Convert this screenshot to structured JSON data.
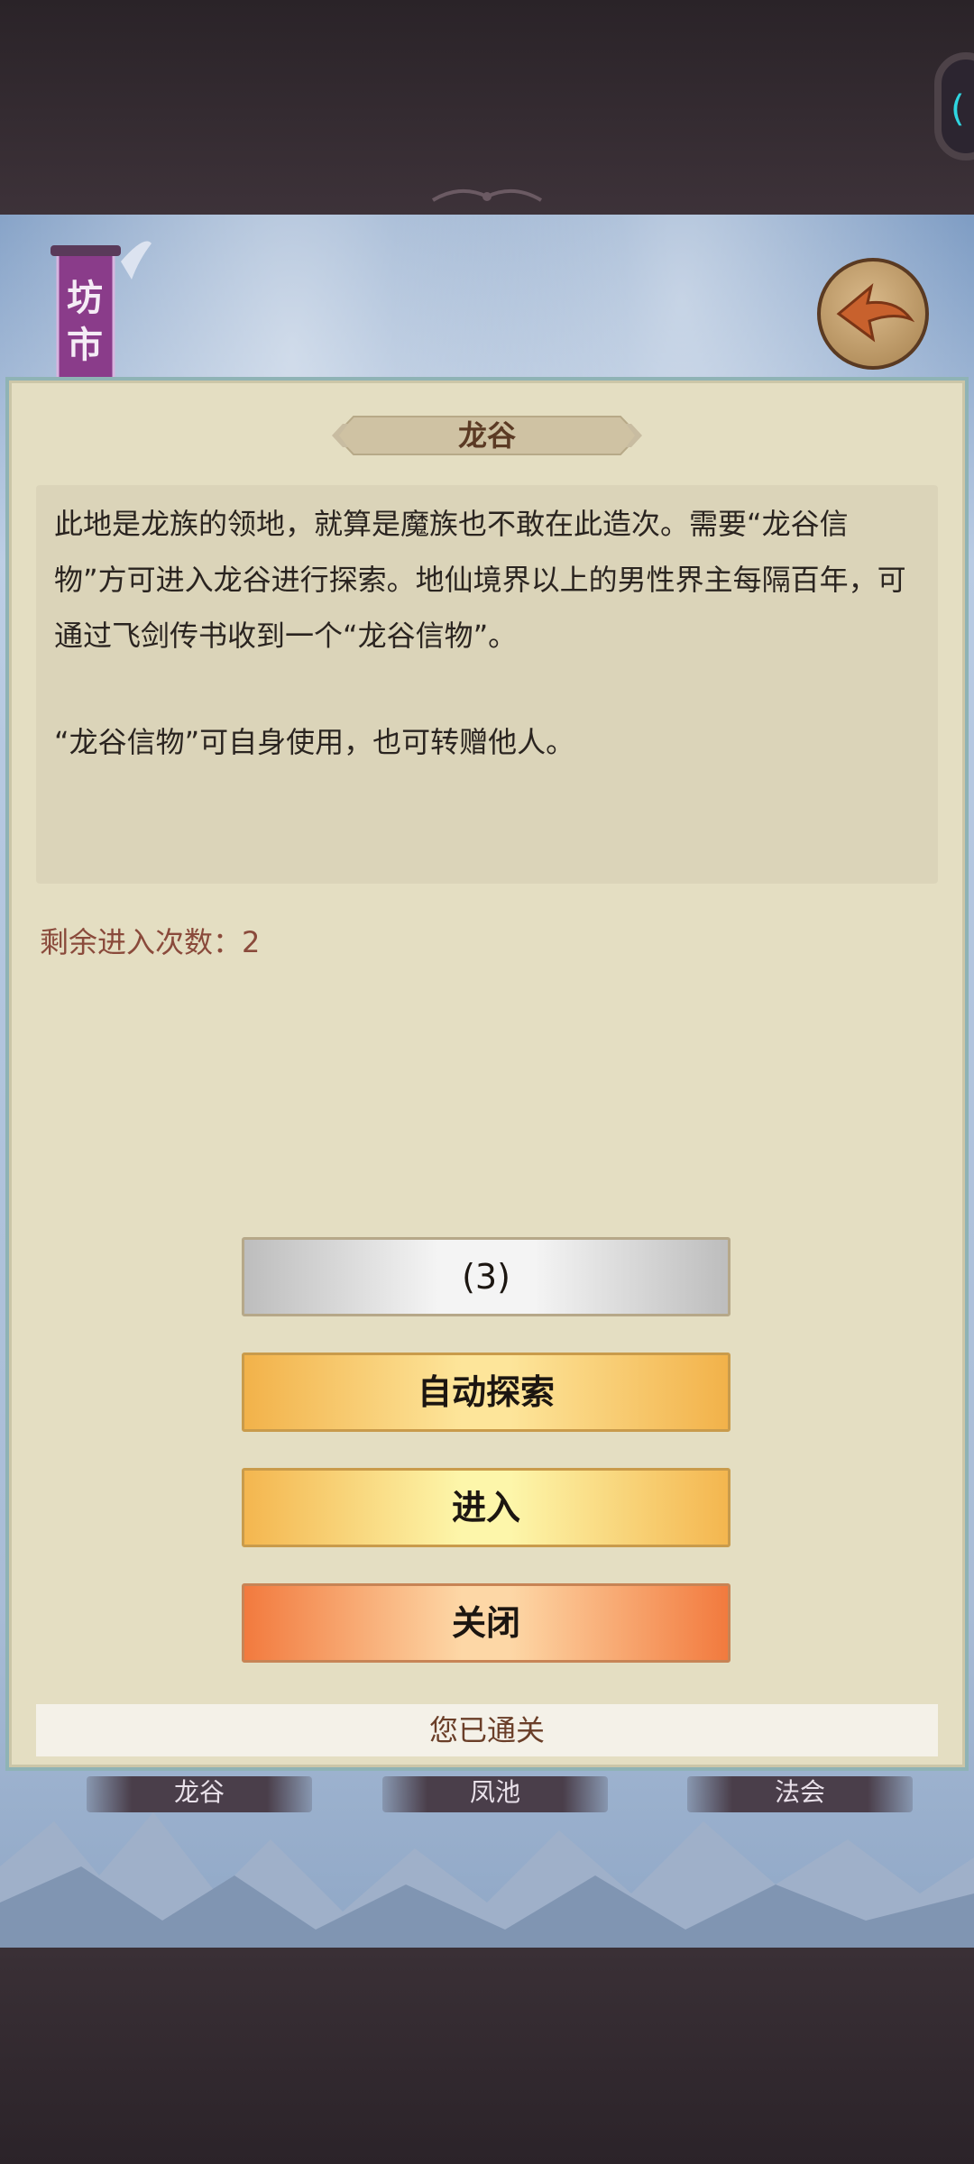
{
  "header": {
    "banner_label": "坊市"
  },
  "panel": {
    "title": "龙谷",
    "description": [
      "此地是龙族的领地，就算是魔族也不敢在此造次。需要“龙谷信物”方可进入龙谷进行探索。地仙境界以上的男性界主每隔百年，可通过飞剑传书收到一个“龙谷信物”。",
      "“龙谷信物”可自身使用，也可转赠他人。"
    ],
    "remaining_label": "剩余进入次数：",
    "remaining_count": "2",
    "buttons": {
      "gray": "(3)",
      "auto_explore": "自动探索",
      "enter": "进入",
      "close": "关闭"
    },
    "status": "您已通关"
  },
  "bottom_tabs": [
    "龙谷",
    "凤池",
    "法会"
  ],
  "colors": {
    "panel_bg": "#e4dec2",
    "title_color": "#5b3a24",
    "remaining_color": "#8a4a3b",
    "accent_cyan": "#2fd5e0"
  }
}
